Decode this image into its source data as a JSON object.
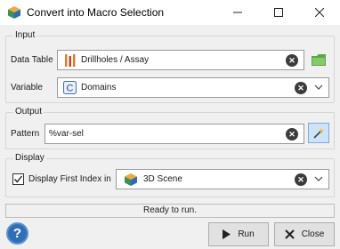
{
  "window": {
    "title": "Convert into Macro Selection",
    "controls": [
      "minimize",
      "maximize",
      "close"
    ]
  },
  "input_group": {
    "title": "Input",
    "data_table": {
      "label": "Data Table",
      "value": "Drillholes / Assay",
      "icon": "drillholes-icon"
    },
    "variable": {
      "label": "Variable",
      "value": "Domains",
      "icon": "categorical-variable-icon"
    }
  },
  "output_group": {
    "title": "Output",
    "pattern": {
      "label": "Pattern",
      "value": "%var-sel"
    }
  },
  "display_group": {
    "title": "Display",
    "checkbox": {
      "label": "Display First Index in",
      "checked": true
    },
    "scene": {
      "value": "3D Scene",
      "icon": "3d-scene-icon"
    }
  },
  "status": {
    "text": "Ready to run."
  },
  "buttons": {
    "help": "?",
    "run": "Run",
    "close": "Close"
  },
  "colors": {
    "accent": "#2f6fb3",
    "drillhole_orange": "#e07b2a",
    "folder_green": "#5aa845"
  }
}
